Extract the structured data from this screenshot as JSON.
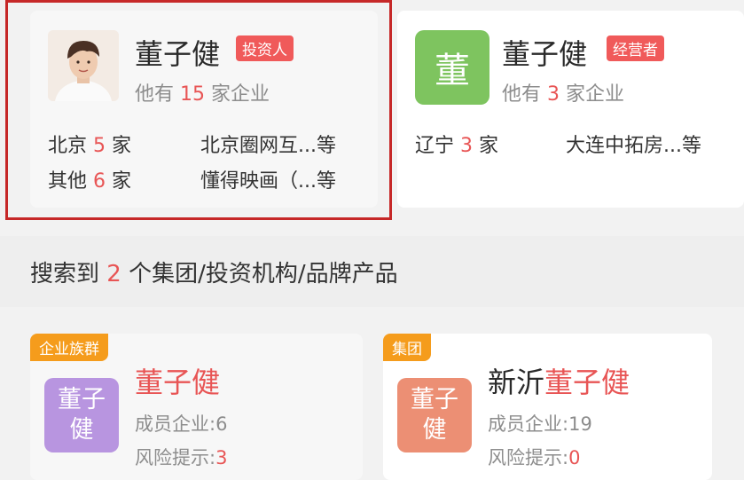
{
  "people": [
    {
      "name": "董子健",
      "role": "投资人",
      "count_prefix": "他有",
      "count": "15",
      "count_suffix": "家企业",
      "regions": [
        {
          "place": "北京",
          "count": "5",
          "unit": "家"
        },
        {
          "place": "其他",
          "count": "6",
          "unit": "家"
        }
      ],
      "companies": [
        {
          "text": "北京圈网互...",
          "suffix": "等"
        },
        {
          "text": "懂得映画（...",
          "suffix": "等"
        }
      ],
      "avatar": "person-photo-icon",
      "badge_color": "#f05a5a"
    },
    {
      "name": "董子健",
      "role": "经营者",
      "count_prefix": "他有",
      "count": "3",
      "count_suffix": "家企业",
      "avatar_text": "董",
      "avatar_color": "#7ec45f",
      "regions": [
        {
          "place": "辽宁",
          "count": "3",
          "unit": "家"
        }
      ],
      "companies": [
        {
          "text": "大连中拓房...",
          "suffix": "等"
        }
      ],
      "badge_color": "#f05a5a"
    }
  ],
  "search_result": {
    "prefix": "搜索到",
    "count": "2",
    "suffix": "个集团/投资机构/品牌产品"
  },
  "groups": [
    {
      "tag": "企业族群",
      "logo_line1": "董子",
      "logo_line2": "健",
      "logo_color": "#b895e0",
      "title_prefix": "",
      "title_highlight": "董子健",
      "members_label": "成员企业:",
      "members": "6",
      "risk_label": "风险提示:",
      "risk": "3"
    },
    {
      "tag": "集团",
      "logo_line1": "董子",
      "logo_line2": "健",
      "logo_color": "#ec8f74",
      "title_prefix": "新沂",
      "title_highlight": "董子健",
      "members_label": "成员企业:",
      "members": "19",
      "risk_label": "风险提示:",
      "risk": "0"
    }
  ],
  "colors": {
    "accent_red": "#e85555",
    "tag_orange": "#f59c1c"
  }
}
